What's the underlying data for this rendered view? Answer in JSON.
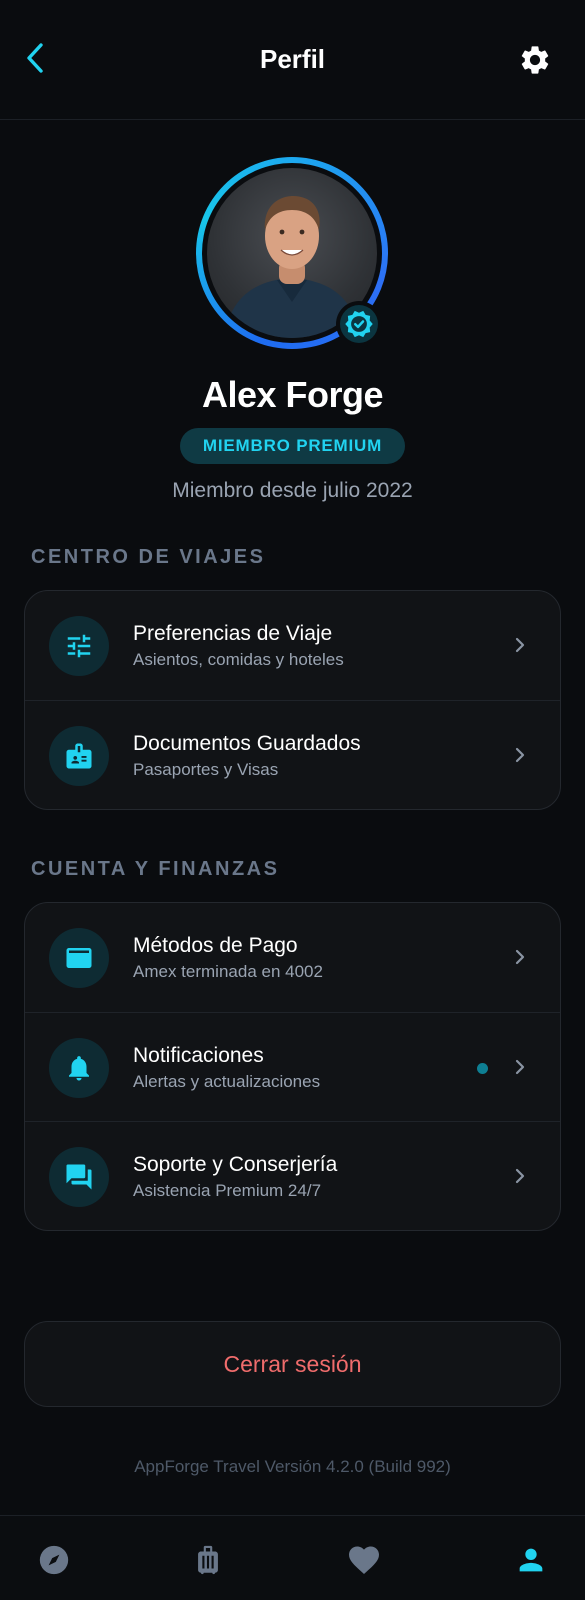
{
  "header": {
    "title": "Perfil",
    "back_icon": "chevron-left-icon",
    "settings_icon": "gear-icon"
  },
  "profile": {
    "name": "Alex Forge",
    "badge": "MIEMBRO PREMIUM",
    "member_since": "Miembro desde julio 2022",
    "verified_icon": "verified-badge-icon"
  },
  "travel_center": {
    "title": "CENTRO DE VIAJES",
    "items": [
      {
        "title": "Preferencias de Viaje",
        "subtitle": "Asientos, comidas y hoteles",
        "icon": "sliders-icon"
      },
      {
        "title": "Documentos Guardados",
        "subtitle": "Pasaportes y Visas",
        "icon": "id-badge-icon"
      }
    ]
  },
  "account": {
    "title": "CUENTA Y FINANZAS",
    "items": [
      {
        "title": "Métodos de Pago",
        "subtitle": "Amex terminada en 4002",
        "icon": "credit-card-icon"
      },
      {
        "title": "Notificaciones",
        "subtitle": "Alertas y actualizaciones",
        "icon": "bell-icon",
        "has_unread_dot": true
      },
      {
        "title": "Soporte y Conserjería",
        "subtitle": "Asistencia Premium 24/7",
        "icon": "chat-bubbles-icon"
      }
    ]
  },
  "logout_label": "Cerrar sesión",
  "version": "AppForge Travel Versión 4.2.0 (Build 992)",
  "bottom_nav": {
    "items": [
      {
        "icon": "compass-icon",
        "active": false
      },
      {
        "icon": "luggage-icon",
        "active": false
      },
      {
        "icon": "heart-icon",
        "active": false
      },
      {
        "icon": "user-icon",
        "active": true
      }
    ]
  },
  "colors": {
    "accent": "#21d3f0",
    "background": "#0a0c0f",
    "card": "#111316",
    "danger": "#f06c6c",
    "muted": "#9aa4b2",
    "nav_inactive": "#6a778a"
  }
}
